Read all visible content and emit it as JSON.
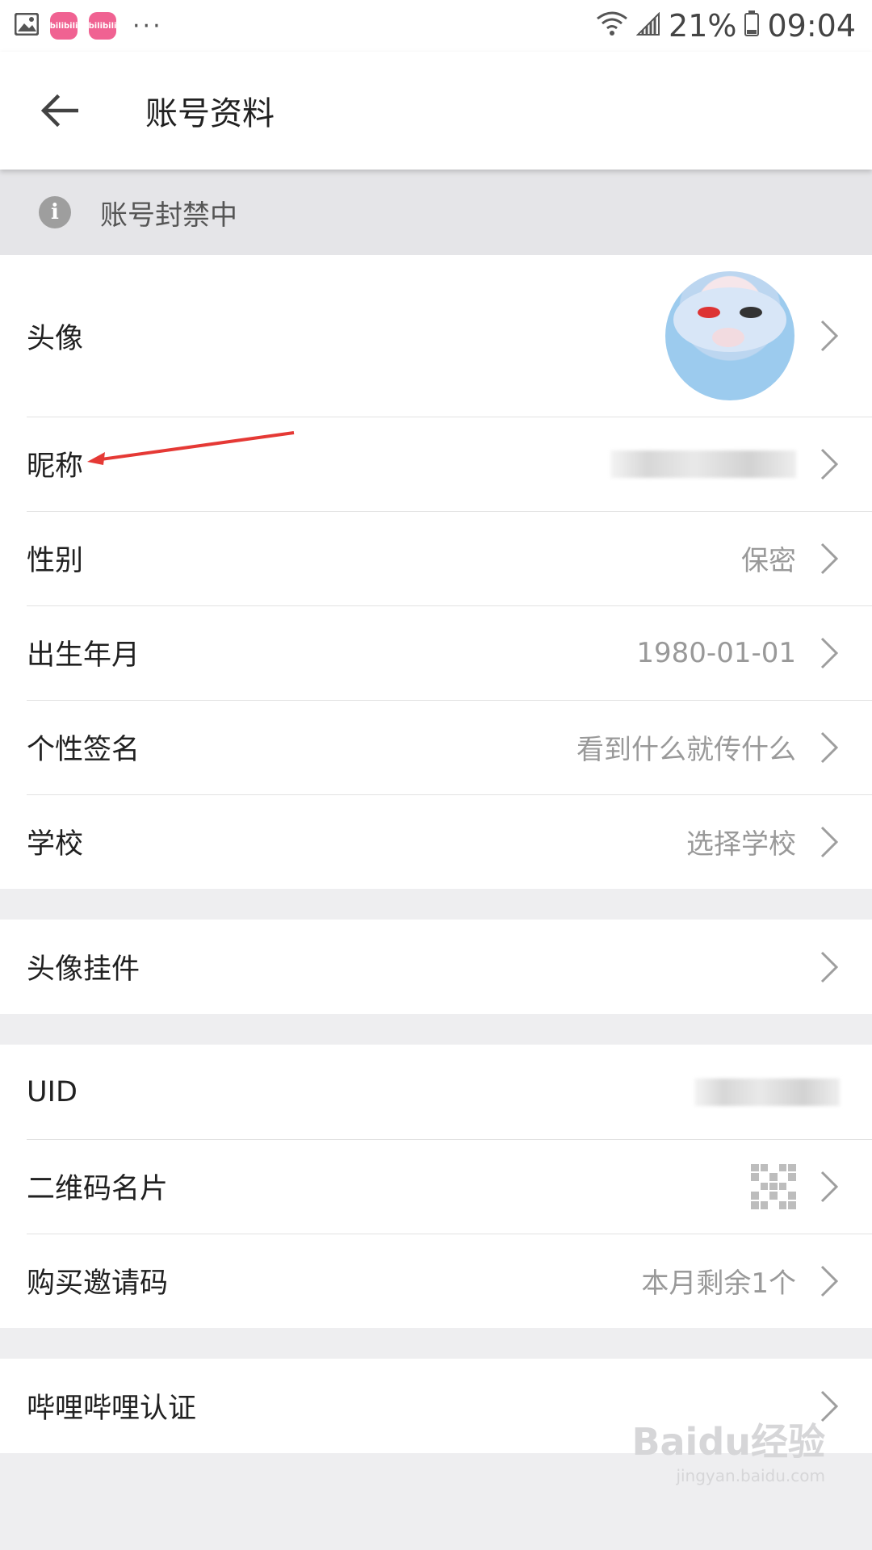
{
  "status_bar": {
    "app_badge_1": "bilibili",
    "app_badge_2": "bilibili",
    "more": "···",
    "battery_percent": "21%",
    "time": "09:04"
  },
  "header": {
    "title": "账号资料"
  },
  "banner": {
    "text": "账号封禁中"
  },
  "profile": {
    "avatar_label": "头像",
    "nickname_label": "昵称",
    "gender_label": "性别",
    "gender_value": "保密",
    "birthday_label": "出生年月",
    "birthday_value": "1980-01-01",
    "signature_label": "个性签名",
    "signature_value": "看到什么就传什么",
    "school_label": "学校",
    "school_value": "选择学校"
  },
  "pendant": {
    "label": "头像挂件"
  },
  "account": {
    "uid_label": "UID",
    "qr_label": "二维码名片",
    "invite_label": "购买邀请码",
    "invite_value": "本月剩余1个"
  },
  "verify": {
    "label": "哔哩哔哩认证"
  },
  "watermark": {
    "text": "Baidu经验",
    "url": "jingyan.baidu.com"
  },
  "colors": {
    "annotation_arrow": "#e53935",
    "secondary_text": "#999999",
    "page_background": "#eeeef0"
  }
}
